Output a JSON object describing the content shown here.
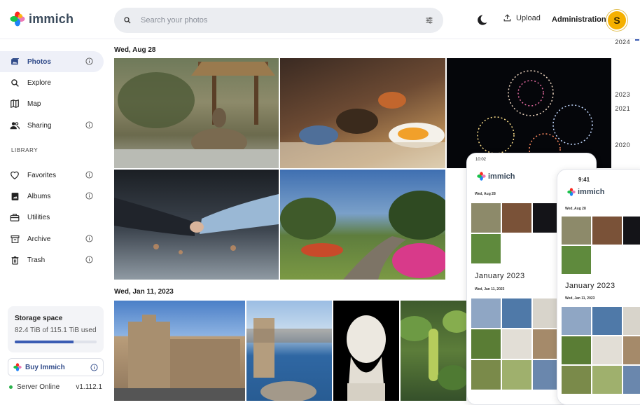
{
  "app": {
    "name": "immich"
  },
  "header": {
    "search_placeholder": "Search your photos",
    "upload_label": "Upload",
    "admin_label": "Administration",
    "avatar_initial": "S"
  },
  "sidebar": {
    "items": [
      {
        "label": "Photos",
        "icon": "photos-icon",
        "info": true,
        "active": true
      },
      {
        "label": "Explore",
        "icon": "search-icon",
        "info": false
      },
      {
        "label": "Map",
        "icon": "map-icon",
        "info": false
      },
      {
        "label": "Sharing",
        "icon": "sharing-icon",
        "info": true
      }
    ],
    "library_label": "LIBRARY",
    "library_items": [
      {
        "label": "Favorites",
        "icon": "heart-icon",
        "info": true
      },
      {
        "label": "Albums",
        "icon": "album-icon",
        "info": true
      },
      {
        "label": "Utilities",
        "icon": "toolbox-icon",
        "info": false
      },
      {
        "label": "Archive",
        "icon": "archive-icon",
        "info": true
      },
      {
        "label": "Trash",
        "icon": "trash-icon",
        "info": true
      }
    ],
    "storage": {
      "title": "Storage space",
      "usage_text": "82.4 TiB of 115.1 TiB used",
      "used_fraction": 0.716
    },
    "buy_label": "Buy Immich",
    "server_status": "Server Online",
    "version": "v1.112.1"
  },
  "timeline": {
    "groups": [
      {
        "date": "Wed, Aug 28"
      },
      {
        "date": "Wed, Jan 11, 2023"
      }
    ],
    "scrubber_years": [
      "2024",
      "2023",
      "2021",
      "2020"
    ]
  },
  "phones": [
    {
      "time": "10:02",
      "app_name": "immich",
      "date1": "Wed, Aug 28",
      "month": "January 2023",
      "date2": "Wed, Jan 11, 2023"
    },
    {
      "time": "9:41",
      "app_name": "immich",
      "date1": "Wed, Aug 28",
      "month": "January 2023",
      "date2": "Wed, Jan 11, 2023"
    }
  ],
  "colors": {
    "accent": "#3b5cb3",
    "active_bg": "#eef0f8",
    "avatar": "#f5b000",
    "online": "#2bb24c"
  }
}
